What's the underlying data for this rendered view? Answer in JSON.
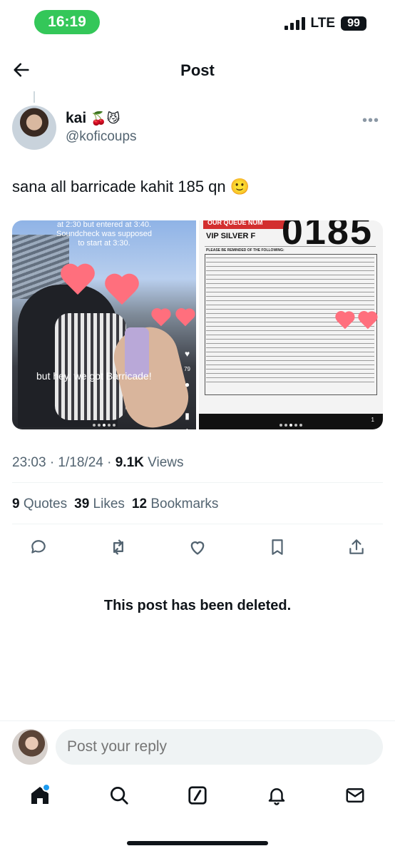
{
  "status_bar": {
    "time": "16:19",
    "network": "LTE",
    "battery": "99"
  },
  "header": {
    "title": "Post"
  },
  "post": {
    "author_name": "kai",
    "author_emojis": "🍒😼",
    "handle": "@koficoups",
    "text": "sana all barricade kahit 185 qn 🙂",
    "media": {
      "image1_top_text": "at 2:30 but entered at 3:40. Soundcheck was supposed to start at 3:30.",
      "image1_caption": "but hey, we got Barricade!",
      "image1_likes": "79",
      "image1_index": "1",
      "image2_number": "0185",
      "image2_header": "OUR QUEUE NUM",
      "image2_label": "VIP SILVER F",
      "image2_subtitle": "PLEASE BE REMINDED OF THE FOLLOWING:",
      "image2_index": "1"
    },
    "timestamp": "23:03 · 1/18/24 · ",
    "views_count": "9.1K",
    "views_label": " Views",
    "quotes_count": "9",
    "quotes_label": "Quotes",
    "likes_count": "39",
    "likes_label": "Likes",
    "bookmarks_count": "12",
    "bookmarks_label": "Bookmarks"
  },
  "deleted_notice": "This post has been deleted.",
  "reply": {
    "placeholder": "Post your reply"
  },
  "icons": {
    "back": "arrow-left-icon",
    "more": "more-horizontal-icon",
    "reply": "comment-icon",
    "repost": "repost-icon",
    "like": "heart-icon",
    "bookmark": "bookmark-icon",
    "share": "share-icon",
    "home": "home-icon",
    "search": "search-icon",
    "grok": "grok-icon",
    "notifications": "bell-icon",
    "messages": "envelope-icon"
  },
  "colors": {
    "accent": "#1d9bf0",
    "time_pill": "#34c759",
    "muted": "#536471"
  }
}
